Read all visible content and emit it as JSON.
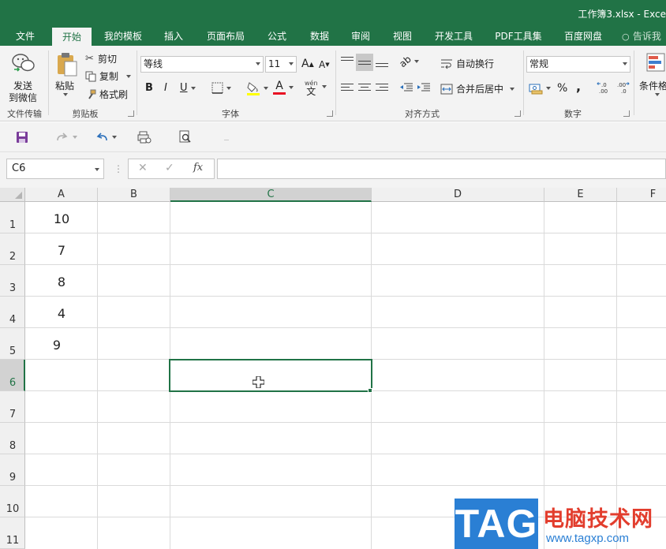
{
  "window": {
    "title": "工作簿3.xlsx - Exce"
  },
  "tabs": [
    {
      "id": "file",
      "label": "文件"
    },
    {
      "id": "home",
      "label": "开始",
      "active": true
    },
    {
      "id": "mytemplates",
      "label": "我的模板"
    },
    {
      "id": "insert",
      "label": "插入"
    },
    {
      "id": "pagelayout",
      "label": "页面布局"
    },
    {
      "id": "formulas",
      "label": "公式"
    },
    {
      "id": "data",
      "label": "数据"
    },
    {
      "id": "review",
      "label": "审阅"
    },
    {
      "id": "view",
      "label": "视图"
    },
    {
      "id": "developer",
      "label": "开发工具"
    },
    {
      "id": "pdftools",
      "label": "PDF工具集"
    },
    {
      "id": "baidu",
      "label": "百度网盘"
    },
    {
      "id": "tellme",
      "label": "告诉我"
    }
  ],
  "ribbon": {
    "send_line1": "发送",
    "send_line2": "到微信",
    "group_file_transfer": "文件传输",
    "paste": "粘贴",
    "cut": "剪切",
    "copy": "复制",
    "format_painter": "格式刷",
    "group_clipboard": "剪贴板",
    "font_name": "等线",
    "font_size": "11",
    "grow_font": "A",
    "shrink_font": "A",
    "bold": "B",
    "italic": "I",
    "underline": "U",
    "font_color_letter": "A",
    "phonetic_top": "wén",
    "phonetic_bottom": "文",
    "group_font": "字体",
    "wrap_text": "自动换行",
    "merge_center": "合并后居中",
    "group_alignment": "对齐方式",
    "number_format": "常规",
    "percent": "%",
    "comma": ",",
    "inc_decimal": "←.0 .00",
    "dec_decimal": ".00 →.0",
    "group_number": "数字",
    "conditional_format": "条件格"
  },
  "formula_bar": {
    "name_box": "C6",
    "cancel": "✕",
    "enter": "✓",
    "fx": "fx",
    "formula": ""
  },
  "sheet": {
    "columns": [
      "A",
      "B",
      "C",
      "D",
      "E",
      "F"
    ],
    "selected_column": "C",
    "rows": [
      "1",
      "2",
      "3",
      "4",
      "5",
      "6",
      "7",
      "8",
      "9",
      "10",
      "11"
    ],
    "selected_row": "6",
    "selected_cell": "C6",
    "col_a_values": [
      "10",
      "7",
      "8",
      "4",
      "9"
    ]
  },
  "watermark": {
    "tag": "TAG",
    "site_cn": "电脑技术网",
    "url": "www.tagxp.com"
  },
  "colors": {
    "excel_green": "#217346",
    "watermark_blue": "#2a7fd4",
    "watermark_red": "#e23d2d"
  }
}
